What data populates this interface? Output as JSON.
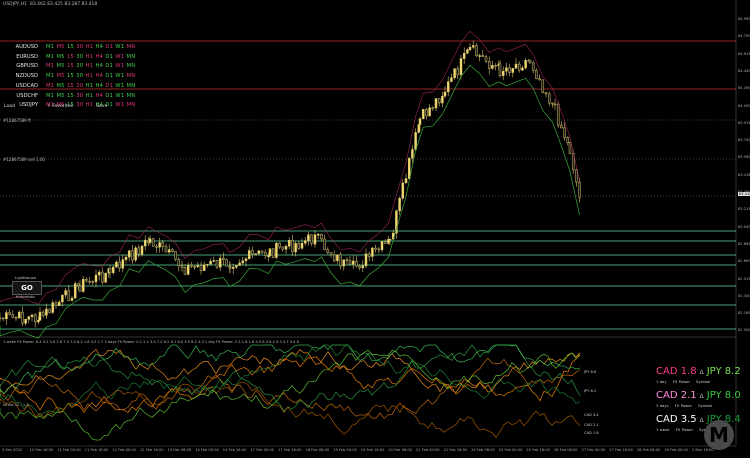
{
  "header": {
    "symbol": "USDJPY,H1",
    "ohlc": "83.462 83.425 83.287 83.418"
  },
  "symbols": [
    {
      "name": "AUDUSD",
      "tfs": [
        "M1",
        "M5",
        "15",
        "30",
        "H1",
        "H4",
        "D1",
        "W1",
        "MN"
      ],
      "colors": [
        "#3ed04a",
        "#e0347a",
        "#3ed04a",
        "#e0347a",
        "#e0347a",
        "#3ed04a",
        "#e0347a",
        "#3ed04a",
        "#e0347a"
      ]
    },
    {
      "name": "EURUSD",
      "tfs": [
        "M1",
        "M5",
        "15",
        "30",
        "H1",
        "H4",
        "D1",
        "W1",
        "MN"
      ],
      "colors": [
        "#3ed04a",
        "#3ed04a",
        "#e0347a",
        "#3ed04a",
        "#e0347a",
        "#e0347a",
        "#3ed04a",
        "#e0347a",
        "#3ed04a"
      ]
    },
    {
      "name": "GBPUSD",
      "tfs": [
        "M1",
        "M5",
        "15",
        "30",
        "H1",
        "H4",
        "D1",
        "W1",
        "MN"
      ],
      "colors": [
        "#e0347a",
        "#3ed04a",
        "#e0347a",
        "#3ed04a",
        "#e0347a",
        "#3ed04a",
        "#3ed04a",
        "#e0347a",
        "#3ed04a"
      ]
    },
    {
      "name": "NZDUSD",
      "tfs": [
        "M1",
        "M5",
        "15",
        "30",
        "H1",
        "H4",
        "D1",
        "W1",
        "MN"
      ],
      "colors": [
        "#3ed04a",
        "#e0347a",
        "#3ed04a",
        "#3ed04a",
        "#e0347a",
        "#e0347a",
        "#3ed04a",
        "#3ed04a",
        "#e0347a"
      ]
    },
    {
      "name": "USDCAD",
      "tfs": [
        "M1",
        "M5",
        "15",
        "30",
        "H1",
        "H4",
        "D1",
        "W1",
        "MN"
      ],
      "colors": [
        "#e0347a",
        "#3ed04a",
        "#e0347a",
        "#e0347a",
        "#3ed04a",
        "#3ed04a",
        "#e0347a",
        "#3ed04a",
        "#3ed04a"
      ]
    },
    {
      "name": "USDCHF",
      "tfs": [
        "M1",
        "M5",
        "15",
        "30",
        "H1",
        "H4",
        "D1",
        "W1",
        "MN"
      ],
      "colors": [
        "#3ed04a",
        "#3ed04a",
        "#3ed04a",
        "#e0347a",
        "#3ed04a",
        "#e0347a",
        "#3ed04a",
        "#3ed04a",
        "#3ed04a"
      ]
    },
    {
      "name": "USDJPY",
      "tfs": [
        "M1",
        "M5",
        "15",
        "30",
        "H1",
        "H4",
        "D1",
        "W1",
        "MN"
      ],
      "colors": [
        "#e0347a",
        "#e0347a",
        "#3ed04a",
        "#e0347a",
        "#e0347a",
        "#3ed04a",
        "#3ed04a",
        "#e0347a",
        "#e0347a"
      ]
    }
  ],
  "buttons": {
    "load": "Load",
    "favorites": "Favorites",
    "save": "Save",
    "favorites_prefix": "+"
  },
  "chart_labels": {
    "label1": "#12867589 ft",
    "label2": "#12867589 sell 1.00"
  },
  "go_panel": {
    "title": "Lighthouse Check",
    "button": "GO",
    "subtitle": "Automatic"
  },
  "yaxis": [
    "84.965",
    "84.790",
    "84.615",
    "84.440",
    "84.265",
    "84.090",
    "83.915",
    "83.740",
    "83.565",
    "83.418",
    "83.390",
    "83.215",
    "83.040",
    "82.865",
    "82.690",
    "82.515",
    "82.340",
    "82.165",
    "82.000"
  ],
  "current_price": "83.418",
  "xaxis": [
    "9 Feb 2020",
    "10 Feb 16:00",
    "11 Feb 00:00",
    "11 Feb 16:00",
    "12 Feb 00:00",
    "12 Feb 16:00",
    "13 Feb 08:00",
    "14 Feb 00:00",
    "14 Feb 16:00",
    "17 Feb 00:00",
    "17 Feb 16:00",
    "18 Feb 08:00",
    "19 Feb 00:00",
    "19 Feb 16:00",
    "20 Feb 08:00",
    "21 Feb 00:00",
    "21 Feb 16:00",
    "24 Feb 08:00",
    "25 Feb 00:00",
    "25 Feb 16:00",
    "26 Feb 08:00",
    "27 Feb 00:00",
    "27 Feb 16:00",
    "28 Feb 08:00",
    "29 Feb 00:00",
    "2 Mar 16:00"
  ],
  "indicator": {
    "header": "1 week FX Power: 8.4 3.2 3.6 2.8 7.5 7.0 6.2 1.8 3.2 2.7   3 days FX Power: 0.1 2.1 3.4 7.0 6.2 6.1 8.0 3.5 8.2 4.0   1 day FX Power: 2.3 1.8 1.6 4.9 8.3 6.2 9.3 4.7 3.4 8",
    "side_label": "Wrote 10 / 1.1",
    "labels": [
      {
        "text": "JPY 8.6",
        "color": "#ff8a00"
      },
      {
        "text": "JPY 8.2",
        "color": "#ff9a20"
      },
      {
        "text": "CAD 3.4",
        "color": "#2ea043"
      },
      {
        "text": "CAD 2.1",
        "color": "#3cc35a"
      },
      {
        "text": "CAD 1.8",
        "color": "#1f8a3a"
      }
    ]
  },
  "strength": [
    {
      "base": "CAD",
      "base_val": "1.8",
      "base_color": "#ff3d8b",
      "quote": "JPY",
      "quote_val": "8.2",
      "quote_color": "#7adf52",
      "period": "1 day",
      "source": "FX Power",
      "sym": "Symbol"
    },
    {
      "base": "CAD",
      "base_val": "2.1",
      "base_color": "#ff8ce0",
      "quote": "JPY",
      "quote_val": "8.0",
      "quote_color": "#3ec53e",
      "period": "3 days",
      "source": "FX Power",
      "sym": "Symbol"
    },
    {
      "base": "CAD",
      "base_val": "3.5",
      "base_color": "#ffffff",
      "quote": "JPY",
      "quote_val": "8.4",
      "quote_color": "#1f9a3a",
      "period": "1 week",
      "source": "FX Power",
      "sym": "Symbol"
    }
  ],
  "watermark": "M"
}
